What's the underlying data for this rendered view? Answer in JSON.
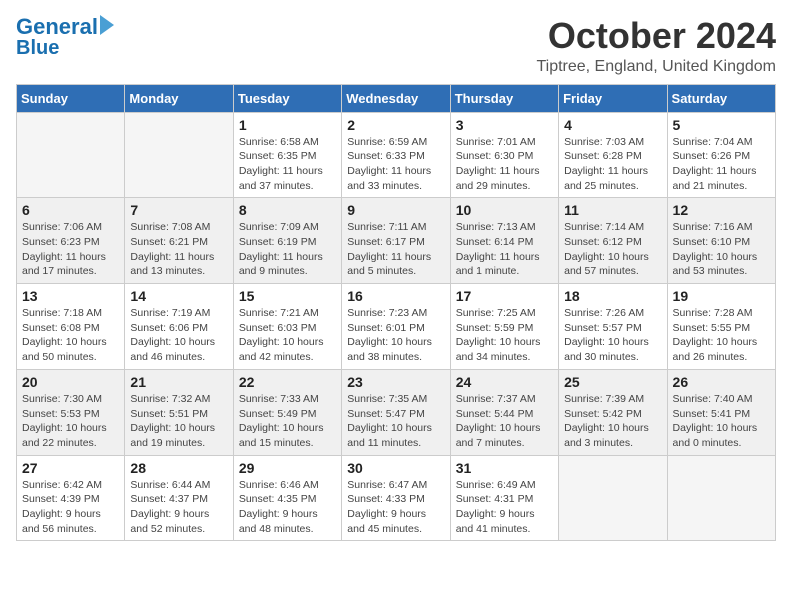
{
  "header": {
    "logo_line1": "General",
    "logo_line2": "Blue",
    "month": "October 2024",
    "location": "Tiptree, England, United Kingdom"
  },
  "weekdays": [
    "Sunday",
    "Monday",
    "Tuesday",
    "Wednesday",
    "Thursday",
    "Friday",
    "Saturday"
  ],
  "weeks": [
    [
      {
        "day": "",
        "sunrise": "",
        "sunset": "",
        "daylight": ""
      },
      {
        "day": "",
        "sunrise": "",
        "sunset": "",
        "daylight": ""
      },
      {
        "day": "1",
        "sunrise": "Sunrise: 6:58 AM",
        "sunset": "Sunset: 6:35 PM",
        "daylight": "Daylight: 11 hours and 37 minutes."
      },
      {
        "day": "2",
        "sunrise": "Sunrise: 6:59 AM",
        "sunset": "Sunset: 6:33 PM",
        "daylight": "Daylight: 11 hours and 33 minutes."
      },
      {
        "day": "3",
        "sunrise": "Sunrise: 7:01 AM",
        "sunset": "Sunset: 6:30 PM",
        "daylight": "Daylight: 11 hours and 29 minutes."
      },
      {
        "day": "4",
        "sunrise": "Sunrise: 7:03 AM",
        "sunset": "Sunset: 6:28 PM",
        "daylight": "Daylight: 11 hours and 25 minutes."
      },
      {
        "day": "5",
        "sunrise": "Sunrise: 7:04 AM",
        "sunset": "Sunset: 6:26 PM",
        "daylight": "Daylight: 11 hours and 21 minutes."
      }
    ],
    [
      {
        "day": "6",
        "sunrise": "Sunrise: 7:06 AM",
        "sunset": "Sunset: 6:23 PM",
        "daylight": "Daylight: 11 hours and 17 minutes."
      },
      {
        "day": "7",
        "sunrise": "Sunrise: 7:08 AM",
        "sunset": "Sunset: 6:21 PM",
        "daylight": "Daylight: 11 hours and 13 minutes."
      },
      {
        "day": "8",
        "sunrise": "Sunrise: 7:09 AM",
        "sunset": "Sunset: 6:19 PM",
        "daylight": "Daylight: 11 hours and 9 minutes."
      },
      {
        "day": "9",
        "sunrise": "Sunrise: 7:11 AM",
        "sunset": "Sunset: 6:17 PM",
        "daylight": "Daylight: 11 hours and 5 minutes."
      },
      {
        "day": "10",
        "sunrise": "Sunrise: 7:13 AM",
        "sunset": "Sunset: 6:14 PM",
        "daylight": "Daylight: 11 hours and 1 minute."
      },
      {
        "day": "11",
        "sunrise": "Sunrise: 7:14 AM",
        "sunset": "Sunset: 6:12 PM",
        "daylight": "Daylight: 10 hours and 57 minutes."
      },
      {
        "day": "12",
        "sunrise": "Sunrise: 7:16 AM",
        "sunset": "Sunset: 6:10 PM",
        "daylight": "Daylight: 10 hours and 53 minutes."
      }
    ],
    [
      {
        "day": "13",
        "sunrise": "Sunrise: 7:18 AM",
        "sunset": "Sunset: 6:08 PM",
        "daylight": "Daylight: 10 hours and 50 minutes."
      },
      {
        "day": "14",
        "sunrise": "Sunrise: 7:19 AM",
        "sunset": "Sunset: 6:06 PM",
        "daylight": "Daylight: 10 hours and 46 minutes."
      },
      {
        "day": "15",
        "sunrise": "Sunrise: 7:21 AM",
        "sunset": "Sunset: 6:03 PM",
        "daylight": "Daylight: 10 hours and 42 minutes."
      },
      {
        "day": "16",
        "sunrise": "Sunrise: 7:23 AM",
        "sunset": "Sunset: 6:01 PM",
        "daylight": "Daylight: 10 hours and 38 minutes."
      },
      {
        "day": "17",
        "sunrise": "Sunrise: 7:25 AM",
        "sunset": "Sunset: 5:59 PM",
        "daylight": "Daylight: 10 hours and 34 minutes."
      },
      {
        "day": "18",
        "sunrise": "Sunrise: 7:26 AM",
        "sunset": "Sunset: 5:57 PM",
        "daylight": "Daylight: 10 hours and 30 minutes."
      },
      {
        "day": "19",
        "sunrise": "Sunrise: 7:28 AM",
        "sunset": "Sunset: 5:55 PM",
        "daylight": "Daylight: 10 hours and 26 minutes."
      }
    ],
    [
      {
        "day": "20",
        "sunrise": "Sunrise: 7:30 AM",
        "sunset": "Sunset: 5:53 PM",
        "daylight": "Daylight: 10 hours and 22 minutes."
      },
      {
        "day": "21",
        "sunrise": "Sunrise: 7:32 AM",
        "sunset": "Sunset: 5:51 PM",
        "daylight": "Daylight: 10 hours and 19 minutes."
      },
      {
        "day": "22",
        "sunrise": "Sunrise: 7:33 AM",
        "sunset": "Sunset: 5:49 PM",
        "daylight": "Daylight: 10 hours and 15 minutes."
      },
      {
        "day": "23",
        "sunrise": "Sunrise: 7:35 AM",
        "sunset": "Sunset: 5:47 PM",
        "daylight": "Daylight: 10 hours and 11 minutes."
      },
      {
        "day": "24",
        "sunrise": "Sunrise: 7:37 AM",
        "sunset": "Sunset: 5:44 PM",
        "daylight": "Daylight: 10 hours and 7 minutes."
      },
      {
        "day": "25",
        "sunrise": "Sunrise: 7:39 AM",
        "sunset": "Sunset: 5:42 PM",
        "daylight": "Daylight: 10 hours and 3 minutes."
      },
      {
        "day": "26",
        "sunrise": "Sunrise: 7:40 AM",
        "sunset": "Sunset: 5:41 PM",
        "daylight": "Daylight: 10 hours and 0 minutes."
      }
    ],
    [
      {
        "day": "27",
        "sunrise": "Sunrise: 6:42 AM",
        "sunset": "Sunset: 4:39 PM",
        "daylight": "Daylight: 9 hours and 56 minutes."
      },
      {
        "day": "28",
        "sunrise": "Sunrise: 6:44 AM",
        "sunset": "Sunset: 4:37 PM",
        "daylight": "Daylight: 9 hours and 52 minutes."
      },
      {
        "day": "29",
        "sunrise": "Sunrise: 6:46 AM",
        "sunset": "Sunset: 4:35 PM",
        "daylight": "Daylight: 9 hours and 48 minutes."
      },
      {
        "day": "30",
        "sunrise": "Sunrise: 6:47 AM",
        "sunset": "Sunset: 4:33 PM",
        "daylight": "Daylight: 9 hours and 45 minutes."
      },
      {
        "day": "31",
        "sunrise": "Sunrise: 6:49 AM",
        "sunset": "Sunset: 4:31 PM",
        "daylight": "Daylight: 9 hours and 41 minutes."
      },
      {
        "day": "",
        "sunrise": "",
        "sunset": "",
        "daylight": ""
      },
      {
        "day": "",
        "sunrise": "",
        "sunset": "",
        "daylight": ""
      }
    ]
  ]
}
